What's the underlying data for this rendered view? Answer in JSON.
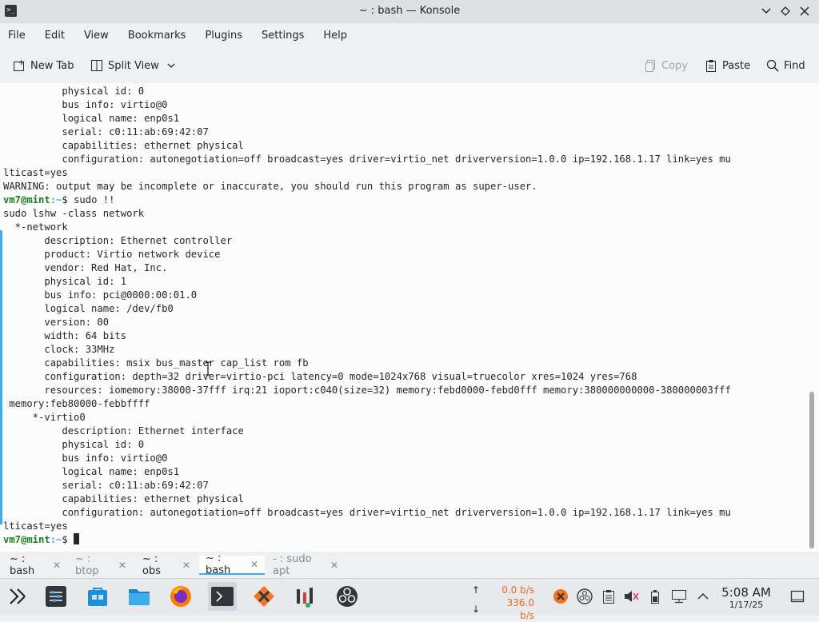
{
  "window": {
    "title": "~ : bash — Konsole",
    "app_icon": ">_"
  },
  "menu": [
    "File",
    "Edit",
    "View",
    "Bookmarks",
    "Plugins",
    "Settings",
    "Help"
  ],
  "toolbar": {
    "new_tab": "New Tab",
    "split_view": "Split View",
    "copy": "Copy",
    "paste": "Paste",
    "find": "Find"
  },
  "terminal": {
    "lines": [
      "          physical id: 0",
      "          bus info: virtio@0",
      "          logical name: enp0s1",
      "          serial: c0:11:ab:69:42:07",
      "          capabilities: ethernet physical",
      "          configuration: autonegotiation=off broadcast=yes driver=virtio_net driverversion=1.0.0 ip=192.168.1.17 link=yes mu",
      "lticast=yes",
      "WARNING: output may be incomplete or inaccurate, you should run this program as super-user.",
      "__PROMPT__ sudo !!",
      "sudo lshw -class network",
      "  *-network",
      "       description: Ethernet controller",
      "       product: Virtio network device",
      "       vendor: Red Hat, Inc.",
      "       physical id: 1",
      "       bus info: pci@0000:00:01.0",
      "       logical name: /dev/fb0",
      "       version: 00",
      "       width: 64 bits",
      "       clock: 33MHz",
      "       capabilities: msix bus_master cap_list rom fb",
      "       configuration: depth=32 driver=virtio-pci latency=0 mode=1024x768 visual=truecolor xres=1024 yres=768",
      "       resources: iomemory:38000-37fff irq:21 ioport:c040(size=32) memory:febd0000-febd0fff memory:380000000000-380000003fff",
      " memory:feb80000-febbffff",
      "     *-virtio0",
      "          description: Ethernet interface",
      "          physical id: 0",
      "          bus info: virtio@0",
      "          logical name: enp0s1",
      "          serial: c0:11:ab:69:42:07",
      "          capabilities: ethernet physical",
      "          configuration: autonegotiation=off broadcast=yes driver=virtio_net driverversion=1.0.0 ip=192.168.1.17 link=yes mu",
      "lticast=yes",
      "__PROMPT__ "
    ],
    "prompt_user": "vm7@mint",
    "prompt_path": ":~",
    "prompt_symbol": "$"
  },
  "tabs": [
    {
      "label": "~ : bash",
      "active": false,
      "dim": false
    },
    {
      "label": "~ : btop",
      "active": false,
      "dim": true
    },
    {
      "label": "~ : obs",
      "active": false,
      "dim": false
    },
    {
      "label": "~ : bash",
      "active": true,
      "dim": false
    },
    {
      "label": "- : sudo apt",
      "active": false,
      "dim": true
    }
  ],
  "taskbar": {
    "net_up_arrow": "↑",
    "net_down_arrow": "↓",
    "net_up": "0.0 b/s",
    "net_down": "336.0 b/s",
    "clock_time": "5:08 AM",
    "clock_date": "1/17/25"
  }
}
